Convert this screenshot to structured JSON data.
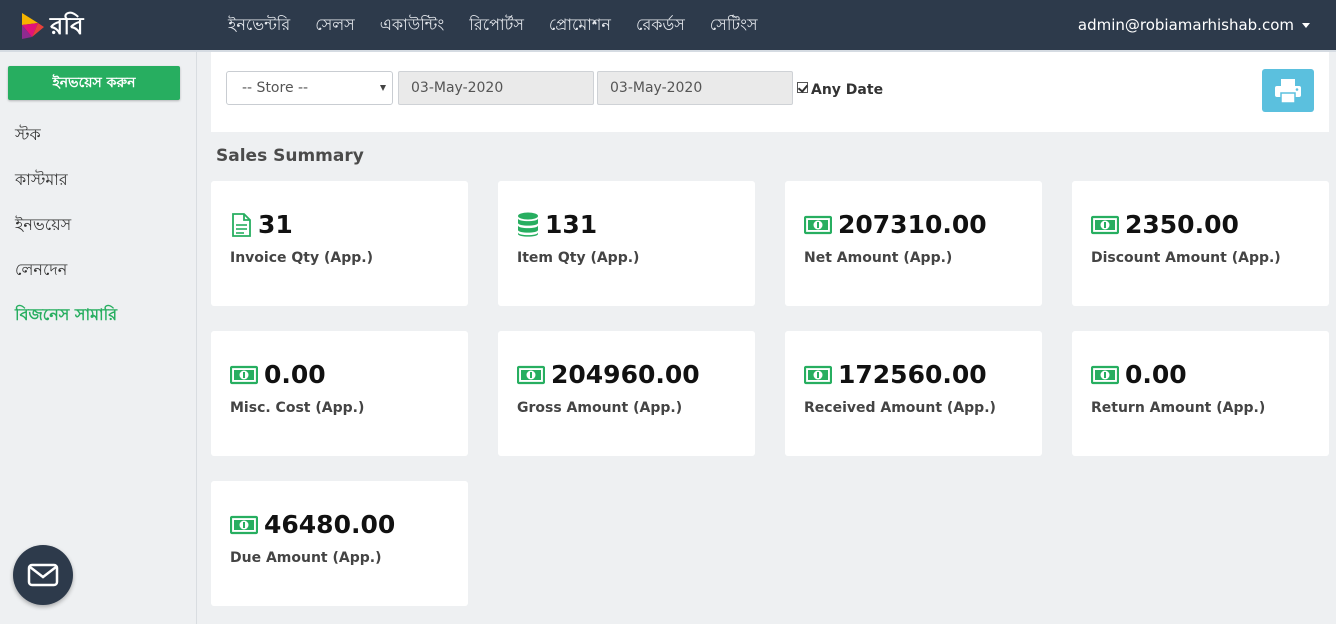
{
  "brand": {
    "name": "রবি"
  },
  "nav": {
    "items": [
      {
        "label": "ইনভেন্টরি"
      },
      {
        "label": "সেলস"
      },
      {
        "label": "একাউন্টিং"
      },
      {
        "label": "রিপোর্টস"
      },
      {
        "label": "প্রোমোশন"
      },
      {
        "label": "রেকর্ডস"
      },
      {
        "label": "সেটিংস"
      }
    ],
    "user": "admin@robiamarhishab.com"
  },
  "sidebar": {
    "create_button": "ইনভয়েস করুন",
    "items": [
      {
        "label": "স্টক"
      },
      {
        "label": "কাস্টমার"
      },
      {
        "label": "ইনভয়েস"
      },
      {
        "label": "লেনদেন"
      },
      {
        "label": "বিজনেস সামারি",
        "active": true
      }
    ]
  },
  "filters": {
    "store": "-- Store --",
    "date_from": "03-May-2020",
    "date_to": "03-May-2020",
    "any_date_label": "Any Date",
    "any_date_checked": true
  },
  "summary": {
    "title": "Sales Summary",
    "cards": [
      {
        "value": "31",
        "label": "Invoice Qty (App.)",
        "icon": "document-icon"
      },
      {
        "value": "131",
        "label": "Item Qty (App.)",
        "icon": "database-icon"
      },
      {
        "value": "207310.00",
        "label": "Net Amount (App.)",
        "icon": "money-icon"
      },
      {
        "value": "2350.00",
        "label": "Discount Amount (App.)",
        "icon": "money-icon"
      },
      {
        "value": "0.00",
        "label": "Misc. Cost (App.)",
        "icon": "money-icon"
      },
      {
        "value": "204960.00",
        "label": "Gross Amount (App.)",
        "icon": "money-icon"
      },
      {
        "value": "172560.00",
        "label": "Received Amount (App.)",
        "icon": "money-icon"
      },
      {
        "value": "0.00",
        "label": "Return Amount (App.)",
        "icon": "money-icon"
      },
      {
        "value": "46480.00",
        "label": "Due Amount (App.)",
        "icon": "money-icon"
      }
    ]
  },
  "colors": {
    "navbar": "#2d3a4b",
    "accent_green": "#27ae60",
    "print_button": "#5bc0de"
  }
}
